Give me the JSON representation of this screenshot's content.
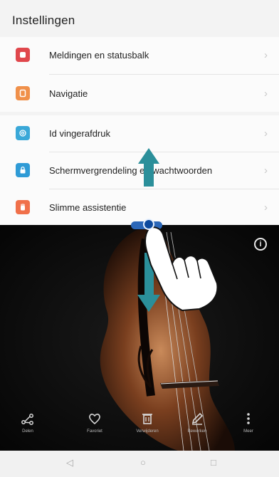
{
  "page": {
    "title": "Instellingen"
  },
  "settings": {
    "group1": [
      {
        "label": "Meldingen en statusbalk",
        "icon": "notification-icon",
        "color": "#e0474c"
      },
      {
        "label": "Navigatie",
        "icon": "navigation-icon",
        "color": "#f0904a"
      }
    ],
    "group2": [
      {
        "label": "Id vingerafdruk",
        "icon": "fingerprint-icon",
        "color": "#3aa8d8"
      },
      {
        "label": "Schermvergrendeling en wachtwoorden",
        "icon": "lock-icon",
        "color": "#2f9bd6"
      },
      {
        "label": "Slimme assistentie",
        "icon": "hand-icon",
        "color": "#f0704a"
      }
    ]
  },
  "photo_toolbar": [
    {
      "label": "Delen",
      "icon": "share-icon"
    },
    {
      "label": "Favoriet",
      "icon": "heart-icon"
    },
    {
      "label": "Verwijderen",
      "icon": "trash-icon"
    },
    {
      "label": "Bewerken",
      "icon": "edit-icon"
    },
    {
      "label": "Meer",
      "icon": "more-icon"
    }
  ],
  "nav_bar": {
    "back": "◁",
    "home": "○",
    "recents": "□"
  },
  "colors": {
    "accent_blue": "#2b67b8",
    "arrow_teal": "#2b8f9a"
  }
}
